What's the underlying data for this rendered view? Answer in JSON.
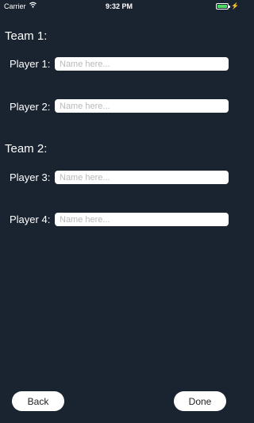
{
  "status_bar": {
    "carrier": "Carrier",
    "time": "9:32 PM"
  },
  "teams": [
    {
      "heading": "Team 1:",
      "players": [
        {
          "label": "Player 1:",
          "value": "",
          "placeholder": "Name here..."
        },
        {
          "label": "Player 2:",
          "value": "",
          "placeholder": "Name here..."
        }
      ]
    },
    {
      "heading": "Team 2:",
      "players": [
        {
          "label": "Player 3:",
          "value": "",
          "placeholder": "Name here..."
        },
        {
          "label": "Player 4:",
          "value": "",
          "placeholder": "Name here..."
        }
      ]
    }
  ],
  "buttons": {
    "back": "Back",
    "done": "Done"
  },
  "colors": {
    "background": "#1a2330",
    "battery": "#4cd964"
  }
}
